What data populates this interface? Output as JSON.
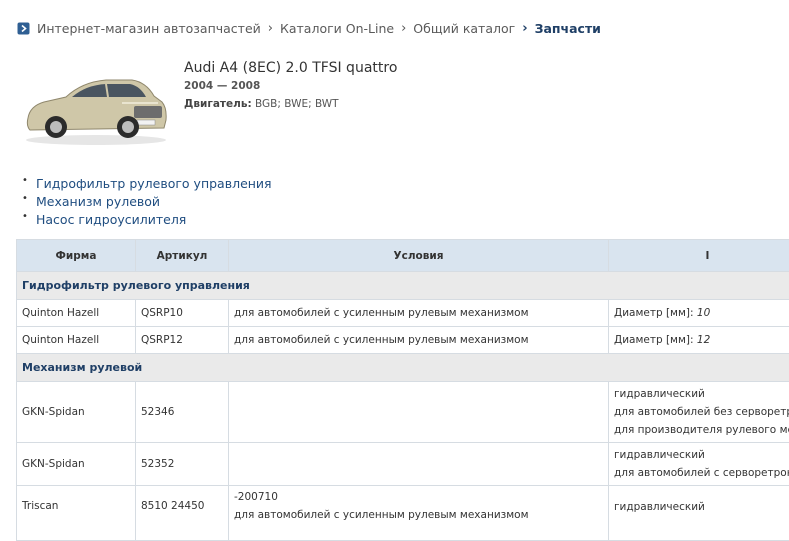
{
  "breadcrumb": {
    "items": [
      "Интернет-магазин автозапчастей",
      "Каталоги On-Line",
      "Общий каталог"
    ],
    "separator": "›",
    "current": "Запчасти"
  },
  "vehicle": {
    "title": "Audi A4 (8EC) 2.0 TFSI quattro",
    "years": "2004 — 2008",
    "engines_label": "Двигатель:",
    "engines": "BGB; BWE; BWT"
  },
  "toc": [
    "Гидрофильтр рулевого управления",
    "Механизм рулевой",
    "Насос гидроусилителя"
  ],
  "table": {
    "headers": [
      "Фирма",
      "Артикул",
      "Условия",
      "I"
    ],
    "groups": [
      {
        "title": "Гидрофильтр рулевого управления",
        "rows": [
          {
            "firm": "Quinton Hazell",
            "article": "QSRP10",
            "conditions": [
              "для автомобилей с усиленным рулевым механизмом"
            ],
            "params": [
              {
                "label": "Диаметр [мм]:",
                "value": "10"
              }
            ]
          },
          {
            "firm": "Quinton Hazell",
            "article": "QSRP12",
            "conditions": [
              "для автомобилей с усиленным рулевым механизмом"
            ],
            "params": [
              {
                "label": "Диаметр [мм]:",
                "value": "12"
              }
            ]
          }
        ]
      },
      {
        "title": "Механизм рулевой",
        "rows": [
          {
            "firm": "GKN-Spidan",
            "article": "52346",
            "conditions": [],
            "params": [
              {
                "label": "гидравлический"
              },
              {
                "label": "для автомобилей без серворетроник"
              },
              {
                "label": "для производителя рулевого меха"
              }
            ]
          },
          {
            "firm": "GKN-Spidan",
            "article": "52352",
            "conditions": [],
            "params": [
              {
                "label": "гидравлический"
              },
              {
                "label": "для автомобилей с серворетроник-р"
              }
            ]
          },
          {
            "firm": "Triscan",
            "article": "8510 24450",
            "conditions": [
              "-200710",
              "для автомобилей с усиленным рулевым механизмом"
            ],
            "params": [
              {
                "label": "гидравлический"
              }
            ]
          }
        ]
      }
    ]
  },
  "colors": {
    "link": "#1f4d80",
    "header_bg": "#d9e4ef",
    "group_bg": "#eaeaea",
    "current_crumb": "#1f3f66"
  }
}
